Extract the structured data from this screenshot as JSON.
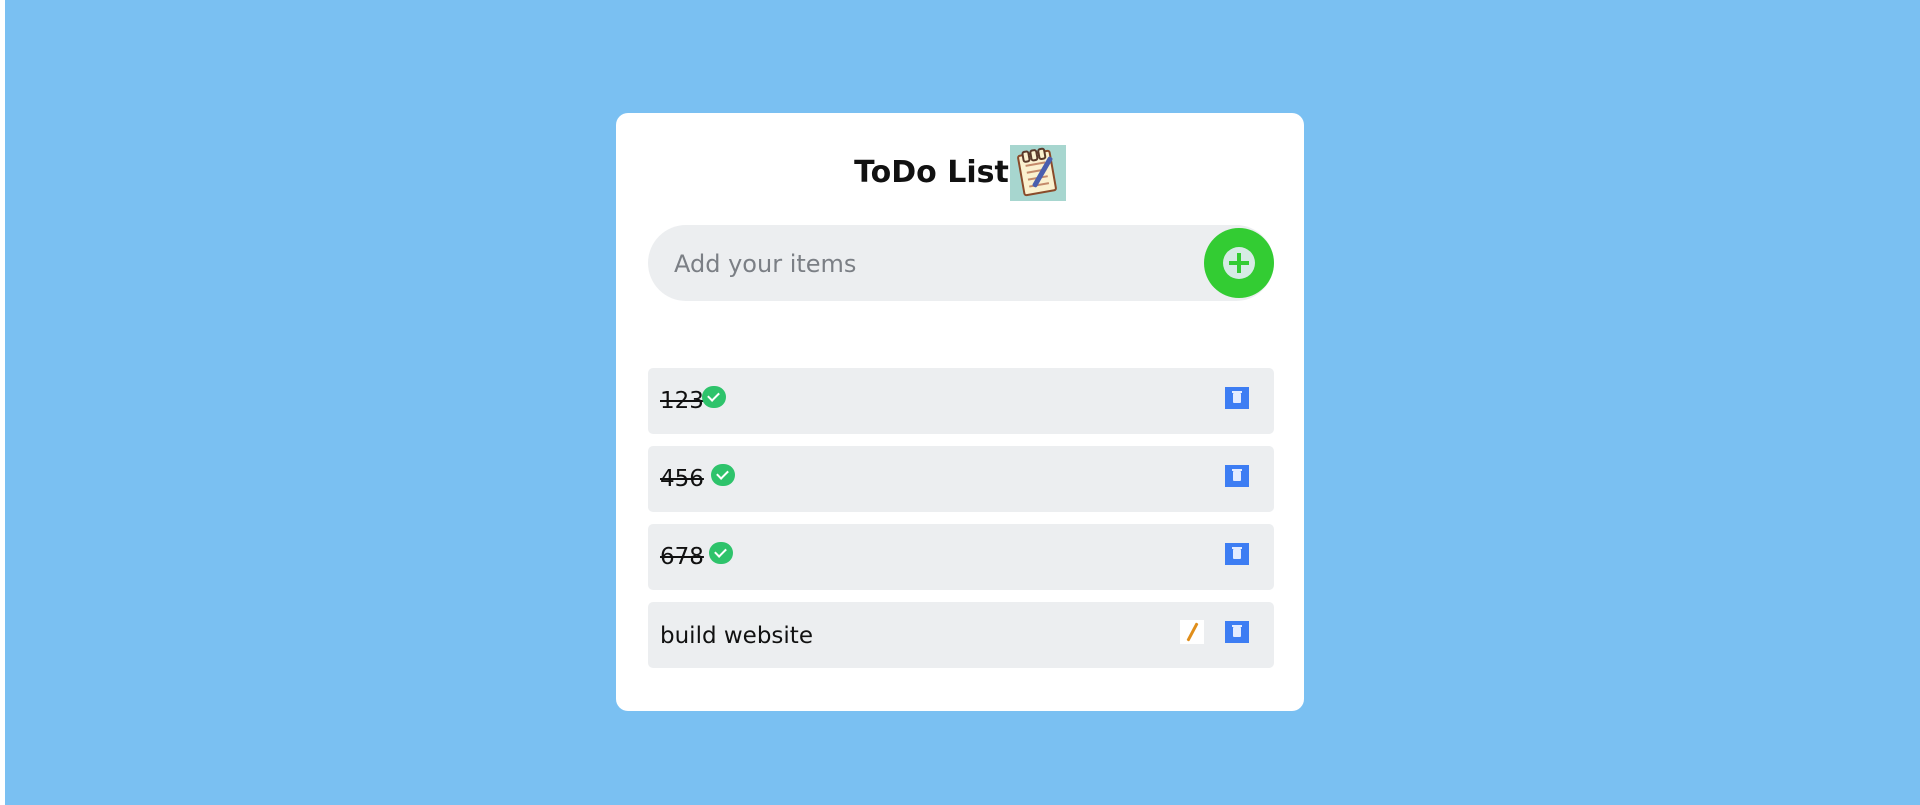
{
  "app": {
    "title": "ToDo List",
    "title_icon": "notepad-icon"
  },
  "input": {
    "placeholder": "Add your items",
    "value": "",
    "add_icon": "plus-circle-icon"
  },
  "todos": [
    {
      "text": "123",
      "completed": true,
      "editable": false
    },
    {
      "text": "456",
      "completed": true,
      "editable": false
    },
    {
      "text": "678",
      "completed": true,
      "editable": false
    },
    {
      "text": "build website",
      "completed": false,
      "editable": true
    }
  ],
  "colors": {
    "background": "#7ac0f2",
    "card": "#ffffff",
    "add_button": "#33cc33",
    "check": "#2ec36b",
    "delete": "#3d7df3",
    "item_bg": "#eceef0"
  }
}
